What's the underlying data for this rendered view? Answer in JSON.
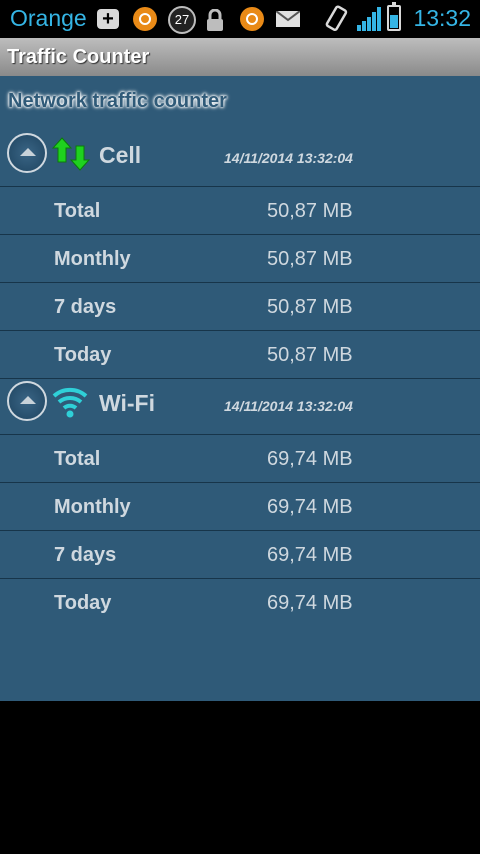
{
  "statusbar": {
    "carrier": "Orange",
    "notification_count": "27",
    "time": "13:32"
  },
  "titlebar": {
    "title": "Traffic Counter"
  },
  "panel": {
    "heading": "Network traffic counter"
  },
  "sections": [
    {
      "name": "Cell",
      "date": "14/11/2014 13:32:04",
      "icon": "up-down-arrows-icon",
      "rows": [
        {
          "label": "Total",
          "value": "50,87 MB"
        },
        {
          "label": "Monthly",
          "value": "50,87 MB"
        },
        {
          "label": "7 days",
          "value": "50,87 MB"
        },
        {
          "label": "Today",
          "value": "50,87 MB"
        }
      ]
    },
    {
      "name": "Wi-Fi",
      "date": "14/11/2014 13:32:04",
      "icon": "wifi-icon",
      "rows": [
        {
          "label": "Total",
          "value": "69,74 MB"
        },
        {
          "label": "Monthly",
          "value": "69,74 MB"
        },
        {
          "label": "7 days",
          "value": "69,74 MB"
        },
        {
          "label": "Today",
          "value": "69,74 MB"
        }
      ]
    }
  ],
  "colors": {
    "panel": "#2f5a78",
    "accent": "#35b5e5",
    "cell_icon": "#1fd11f",
    "wifi_icon": "#2fd0d8"
  }
}
